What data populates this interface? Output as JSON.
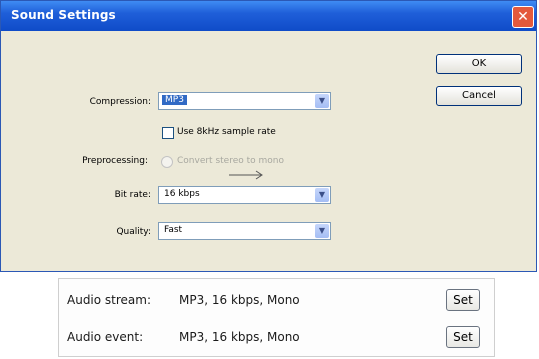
{
  "dialog": {
    "title": "Sound Settings",
    "close_glyph": "✕",
    "ok_label": "OK",
    "cancel_label": "Cancel",
    "compression_label": "Compression:",
    "compression_value": "MP3",
    "sample_rate_checkbox_label": "Use 8kHz sample rate",
    "preprocessing_label": "Preprocessing:",
    "preprocessing_option": "Convert stereo to mono",
    "bit_rate_label": "Bit rate:",
    "bit_rate_value": "16 kbps",
    "quality_label": "Quality:",
    "quality_value": "Fast"
  },
  "audio": {
    "stream_label": "Audio stream:",
    "stream_value": "MP3, 16 kbps, Mono",
    "event_label": "Audio event:",
    "event_value": "MP3, 16 kbps, Mono",
    "set_label": "Set"
  },
  "colors": {
    "titlebar": "#0f4bc8",
    "dialog_bg": "#ece9d8",
    "selection": "#316ac5"
  }
}
